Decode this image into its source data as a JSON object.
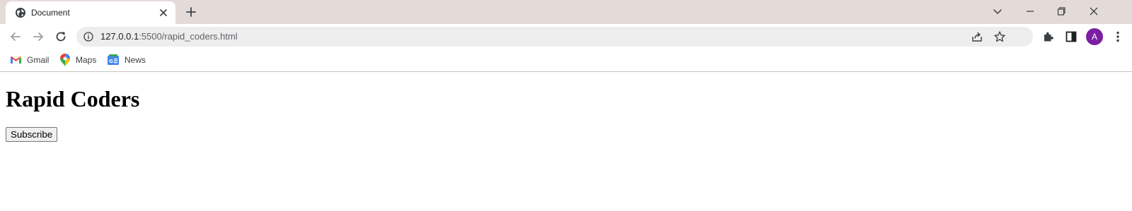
{
  "tab": {
    "title": "Document",
    "favicon": "globe-icon"
  },
  "address_bar": {
    "url_host": "127.0.0.1",
    "url_path": ":5500/rapid_coders.html"
  },
  "profile": {
    "initial": "A",
    "color": "#7b1fa2"
  },
  "bookmarks": [
    {
      "label": "Gmail",
      "icon": "gmail-icon"
    },
    {
      "label": "Maps",
      "icon": "maps-icon"
    },
    {
      "label": "News",
      "icon": "news-icon"
    }
  ],
  "page": {
    "heading": "Rapid Coders",
    "button_label": "Subscribe"
  },
  "colors": {
    "tabstrip_bg": "#e4dbd9",
    "omnibox_bg": "#ededed",
    "avatar": "#7b1fa2"
  }
}
